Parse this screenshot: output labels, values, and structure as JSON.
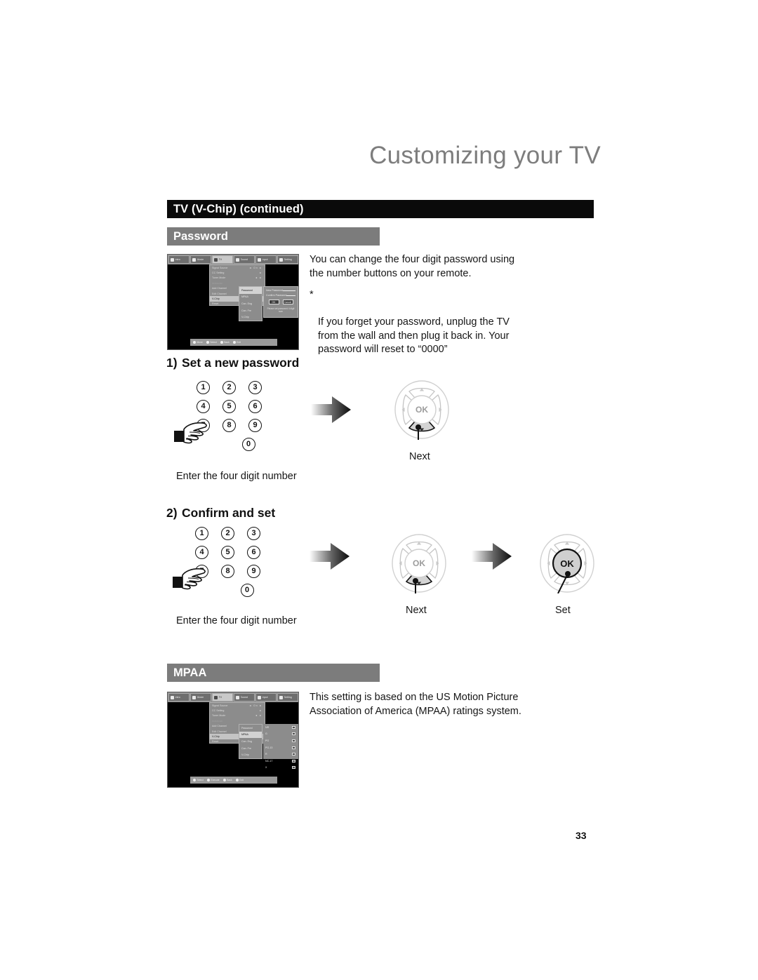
{
  "header": {
    "title": "Customizing your TV",
    "title_color": "#7d7d7d"
  },
  "section_bar": {
    "label": "TV (V-Chip) (continued)",
    "bg": "#0a0a0a"
  },
  "password_section": {
    "bar_label": "Password",
    "bar_bg": "#7c7c7c",
    "paragraph1": "You can change the four digit password using\nthe number buttons on your remote.",
    "note_marker": "*",
    "note_text": "If you forget your password, unplug the TV\nfrom the wall and then plug it back in.  Your\npassword will reset to “0000”",
    "tv_screenshot": {
      "menubar": [
        {
          "label": "Intro",
          "icon": "screen-icon",
          "active": false
        },
        {
          "label": "Movie",
          "icon": "movie-icon",
          "active": false
        },
        {
          "label": "TV",
          "icon": "tv-icon",
          "active": true
        },
        {
          "label": "Sound",
          "icon": "music-note-icon",
          "active": false
        },
        {
          "label": "Input",
          "icon": "input-icon",
          "active": false
        },
        {
          "label": "Setting",
          "icon": "settings-icon",
          "active": false
        }
      ],
      "menu1": [
        {
          "label": "Signal Source",
          "arrows": "◄  On  ►",
          "state": "normal"
        },
        {
          "label": "CC Setting",
          "arrows": "►",
          "state": "normal"
        },
        {
          "label": "Tuner Mode",
          "arrows": "◄  ► ",
          "state": "normal"
        },
        {
          "label": "Autoscan",
          "arrows": "",
          "state": "dim"
        },
        {
          "label": "Add Channel",
          "arrows": "►",
          "state": "normal"
        },
        {
          "label": "Edit Channel",
          "arrows": "►",
          "state": "normal"
        },
        {
          "label": "V-Chip",
          "arrows": "►",
          "state": "selected"
        },
        {
          "label": "Reset",
          "arrows": "",
          "state": "normal"
        }
      ],
      "menu2": [
        {
          "label": "Password",
          "state": "selected"
        },
        {
          "label": "MPAA",
          "state": "normal"
        },
        {
          "label": "Can. Eng",
          "state": "normal"
        },
        {
          "label": "Can. Fre",
          "state": "normal"
        },
        {
          "label": "V-Chip",
          "state": "normal"
        }
      ],
      "dialog": {
        "field1_label": "New Password",
        "field2_label": "Confirm Password",
        "ok_label": "OK",
        "cancel_label": "Cancel",
        "note": "Please set password 4 digit num"
      },
      "footer": [
        {
          "label": "Move",
          "icon": "dpad-icon"
        },
        {
          "label": "Select",
          "icon": "ok-icon"
        },
        {
          "label": "Back",
          "icon": "back-icon"
        },
        {
          "label": "Exit",
          "icon": "exit-icon"
        }
      ]
    }
  },
  "steps": [
    {
      "number": "1)",
      "title": "Set a new password",
      "keypad": [
        [
          "1",
          "2",
          "3"
        ],
        [
          "4",
          "5",
          "6"
        ],
        [
          "7",
          "8",
          "9"
        ],
        [
          "0"
        ]
      ],
      "caption": "Enter the four digit number",
      "wheels": [
        {
          "name": "next-wheel",
          "center_label": "OK",
          "highlight": "down",
          "label": "Next"
        }
      ]
    },
    {
      "number": "2)",
      "title": "Confirm and set",
      "keypad": [
        [
          "1",
          "2",
          "3"
        ],
        [
          "4",
          "5",
          "6"
        ],
        [
          "7",
          "8",
          "9"
        ],
        [
          "0"
        ]
      ],
      "caption": "Enter the four digit number",
      "wheels": [
        {
          "name": "next-wheel",
          "center_label": "OK",
          "highlight": "down",
          "label": "Next"
        },
        {
          "name": "set-wheel",
          "center_label": "OK",
          "highlight": "center",
          "label": "Set"
        }
      ]
    }
  ],
  "mpaa_section": {
    "bar_label": "MPAA",
    "bar_bg": "#7c7c7c",
    "paragraph": "This setting is based on the US Motion Picture\nAssociation of America (MPAA) ratings system.",
    "tv_screenshot": {
      "menubar": [
        {
          "label": "Intro",
          "icon": "screen-icon",
          "active": false
        },
        {
          "label": "Movie",
          "icon": "movie-icon",
          "active": false
        },
        {
          "label": "TV",
          "icon": "tv-icon",
          "active": true
        },
        {
          "label": "Sound",
          "icon": "music-note-icon",
          "active": false
        },
        {
          "label": "Input",
          "icon": "input-icon",
          "active": false
        },
        {
          "label": "Setting",
          "icon": "settings-icon",
          "active": false
        }
      ],
      "menu1": [
        {
          "label": "Signal Source",
          "arrows": "◄  On  ►",
          "state": "normal"
        },
        {
          "label": "CC Setting",
          "arrows": "►",
          "state": "normal"
        },
        {
          "label": "Tuner Mode",
          "arrows": "◄  ► ",
          "state": "normal"
        },
        {
          "label": "Autoscan",
          "arrows": "",
          "state": "dim"
        },
        {
          "label": "Add Channel",
          "arrows": "►",
          "state": "normal"
        },
        {
          "label": "Edit Channel",
          "arrows": "►",
          "state": "normal"
        },
        {
          "label": "V-Chip",
          "arrows": "►",
          "state": "selected"
        },
        {
          "label": "Reset",
          "arrows": "",
          "state": "normal"
        }
      ],
      "menu2": [
        {
          "label": "Password",
          "state": "normal"
        },
        {
          "label": "MPAA",
          "state": "selected"
        },
        {
          "label": "Can. Eng",
          "state": "normal"
        },
        {
          "label": "Can. Fre",
          "state": "normal"
        },
        {
          "label": "V-Chip",
          "state": "normal"
        }
      ],
      "ratings": [
        {
          "label": "NR",
          "checked": true
        },
        {
          "label": "G",
          "checked": true
        },
        {
          "label": "PG",
          "checked": true
        },
        {
          "label": "PG-13",
          "checked": true
        },
        {
          "label": "R",
          "checked": true
        },
        {
          "label": "NC-17",
          "checked": true
        },
        {
          "label": "X",
          "checked": true
        }
      ],
      "footer": [
        {
          "label": "Select",
          "icon": "dpad-icon"
        },
        {
          "label": "Execute",
          "icon": "ok-icon"
        },
        {
          "label": "Back",
          "icon": "back-icon"
        },
        {
          "label": "Exit",
          "icon": "exit-icon"
        }
      ]
    }
  },
  "footer": {
    "page_number": "33"
  }
}
